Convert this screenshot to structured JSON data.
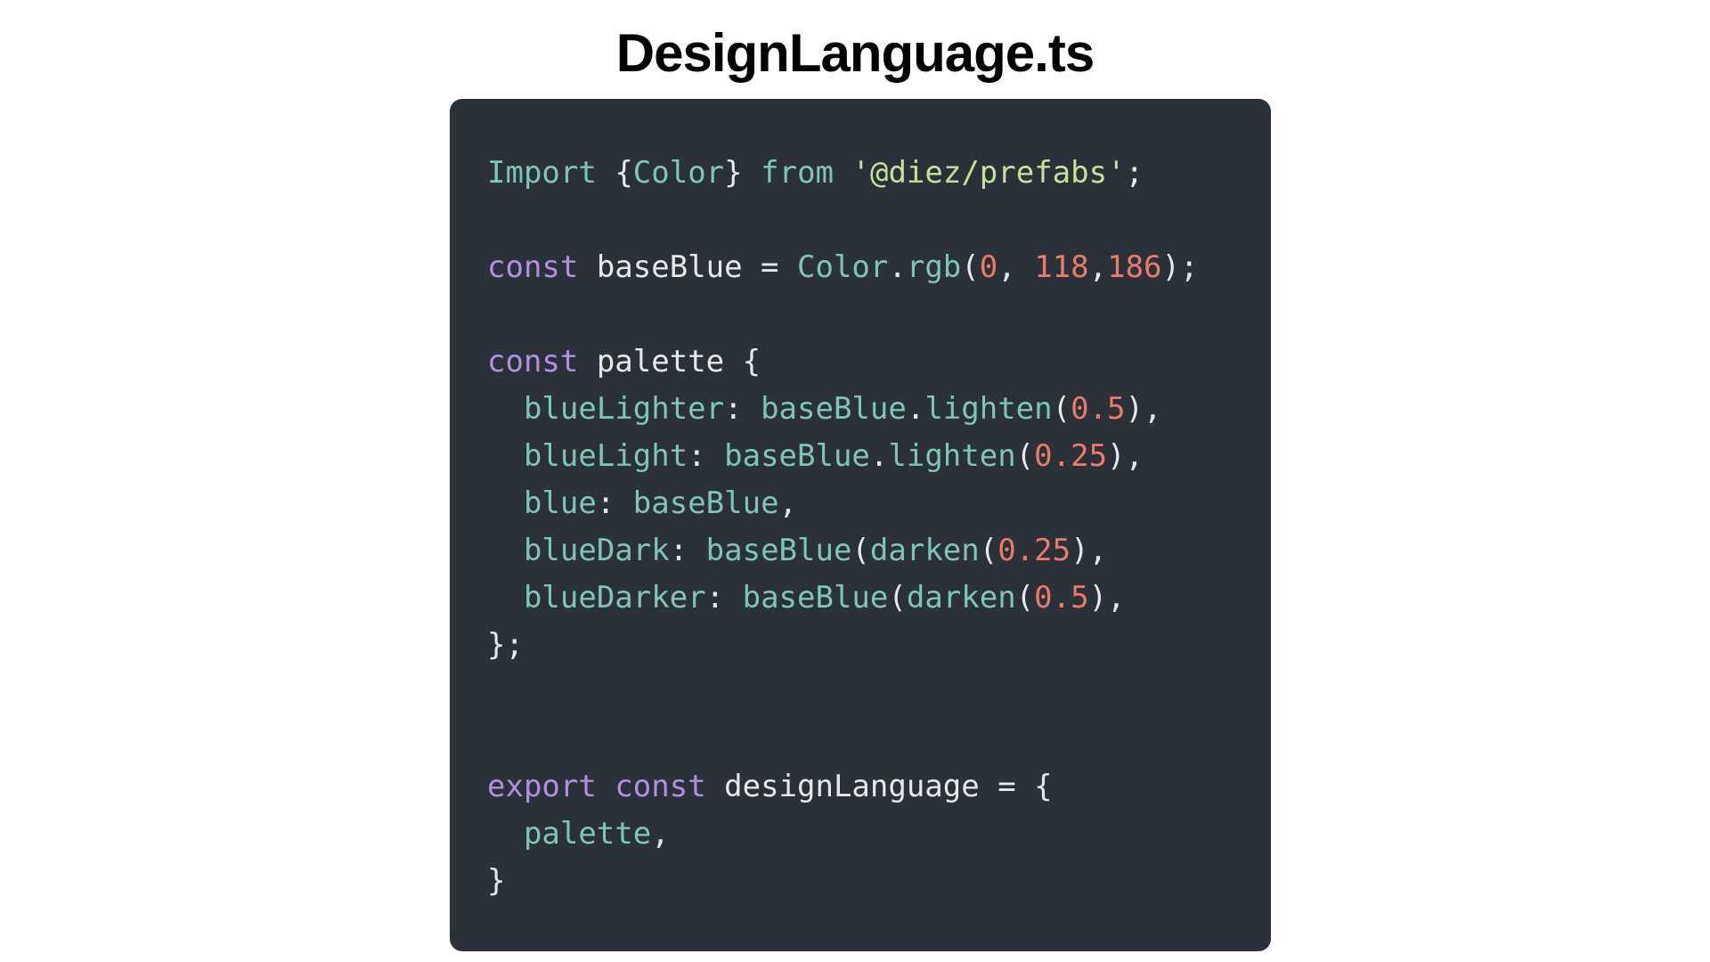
{
  "title": "DesignLanguage.ts",
  "colors": {
    "keyword": "#b48ee0",
    "identifier": "#e6e8ea",
    "type": "#7fc4b8",
    "string": "#c4e09a",
    "number": "#ea7a6a",
    "punct": "#e6e8ea",
    "background": "#2b3139"
  },
  "code_lines": [
    [
      {
        "t": "Import",
        "c": "type"
      },
      {
        "t": " ",
        "c": "punct"
      },
      {
        "t": "{",
        "c": "punct"
      },
      {
        "t": "Color",
        "c": "type"
      },
      {
        "t": "}",
        "c": "punct"
      },
      {
        "t": " ",
        "c": "punct"
      },
      {
        "t": "from",
        "c": "type"
      },
      {
        "t": " ",
        "c": "punct"
      },
      {
        "t": "'@diez/prefabs'",
        "c": "string"
      },
      {
        "t": ";",
        "c": "punct"
      }
    ],
    [],
    [
      {
        "t": "const",
        "c": "keyword"
      },
      {
        "t": " baseBlue = ",
        "c": "identifier"
      },
      {
        "t": "Color",
        "c": "type"
      },
      {
        "t": ".",
        "c": "punct"
      },
      {
        "t": "rgb",
        "c": "type"
      },
      {
        "t": "(",
        "c": "punct"
      },
      {
        "t": "0",
        "c": "number"
      },
      {
        "t": ", ",
        "c": "punct"
      },
      {
        "t": "118",
        "c": "number"
      },
      {
        "t": ",",
        "c": "punct"
      },
      {
        "t": "186",
        "c": "number"
      },
      {
        "t": ");",
        "c": "punct"
      }
    ],
    [],
    [
      {
        "t": "const",
        "c": "keyword"
      },
      {
        "t": " palette {",
        "c": "identifier"
      }
    ],
    [
      {
        "t": "  blueLighter",
        "c": "type"
      },
      {
        "t": ": ",
        "c": "punct"
      },
      {
        "t": "baseBlue",
        "c": "type"
      },
      {
        "t": ".",
        "c": "punct"
      },
      {
        "t": "lighten",
        "c": "type"
      },
      {
        "t": "(",
        "c": "punct"
      },
      {
        "t": "0.5",
        "c": "number"
      },
      {
        "t": "),",
        "c": "punct"
      }
    ],
    [
      {
        "t": "  blueLight",
        "c": "type"
      },
      {
        "t": ": ",
        "c": "punct"
      },
      {
        "t": "baseBlue",
        "c": "type"
      },
      {
        "t": ".",
        "c": "punct"
      },
      {
        "t": "lighten",
        "c": "type"
      },
      {
        "t": "(",
        "c": "punct"
      },
      {
        "t": "0.25",
        "c": "number"
      },
      {
        "t": "),",
        "c": "punct"
      }
    ],
    [
      {
        "t": "  blue",
        "c": "type"
      },
      {
        "t": ": ",
        "c": "punct"
      },
      {
        "t": "baseBlue",
        "c": "type"
      },
      {
        "t": ",",
        "c": "punct"
      }
    ],
    [
      {
        "t": "  blueDark",
        "c": "type"
      },
      {
        "t": ": ",
        "c": "punct"
      },
      {
        "t": "baseBlue",
        "c": "type"
      },
      {
        "t": "(",
        "c": "punct"
      },
      {
        "t": "darken",
        "c": "type"
      },
      {
        "t": "(",
        "c": "punct"
      },
      {
        "t": "0.25",
        "c": "number"
      },
      {
        "t": "),",
        "c": "punct"
      }
    ],
    [
      {
        "t": "  blueDarker",
        "c": "type"
      },
      {
        "t": ": ",
        "c": "punct"
      },
      {
        "t": "baseBlue",
        "c": "type"
      },
      {
        "t": "(",
        "c": "punct"
      },
      {
        "t": "darken",
        "c": "type"
      },
      {
        "t": "(",
        "c": "punct"
      },
      {
        "t": "0.5",
        "c": "number"
      },
      {
        "t": "),",
        "c": "punct"
      }
    ],
    [
      {
        "t": "};",
        "c": "punct"
      }
    ],
    [],
    [],
    [
      {
        "t": "export",
        "c": "keyword"
      },
      {
        "t": " ",
        "c": "punct"
      },
      {
        "t": "const",
        "c": "keyword"
      },
      {
        "t": " designLanguage = {",
        "c": "identifier"
      }
    ],
    [
      {
        "t": "  palette",
        "c": "type"
      },
      {
        "t": ",",
        "c": "punct"
      }
    ],
    [
      {
        "t": "}",
        "c": "punct"
      }
    ]
  ]
}
